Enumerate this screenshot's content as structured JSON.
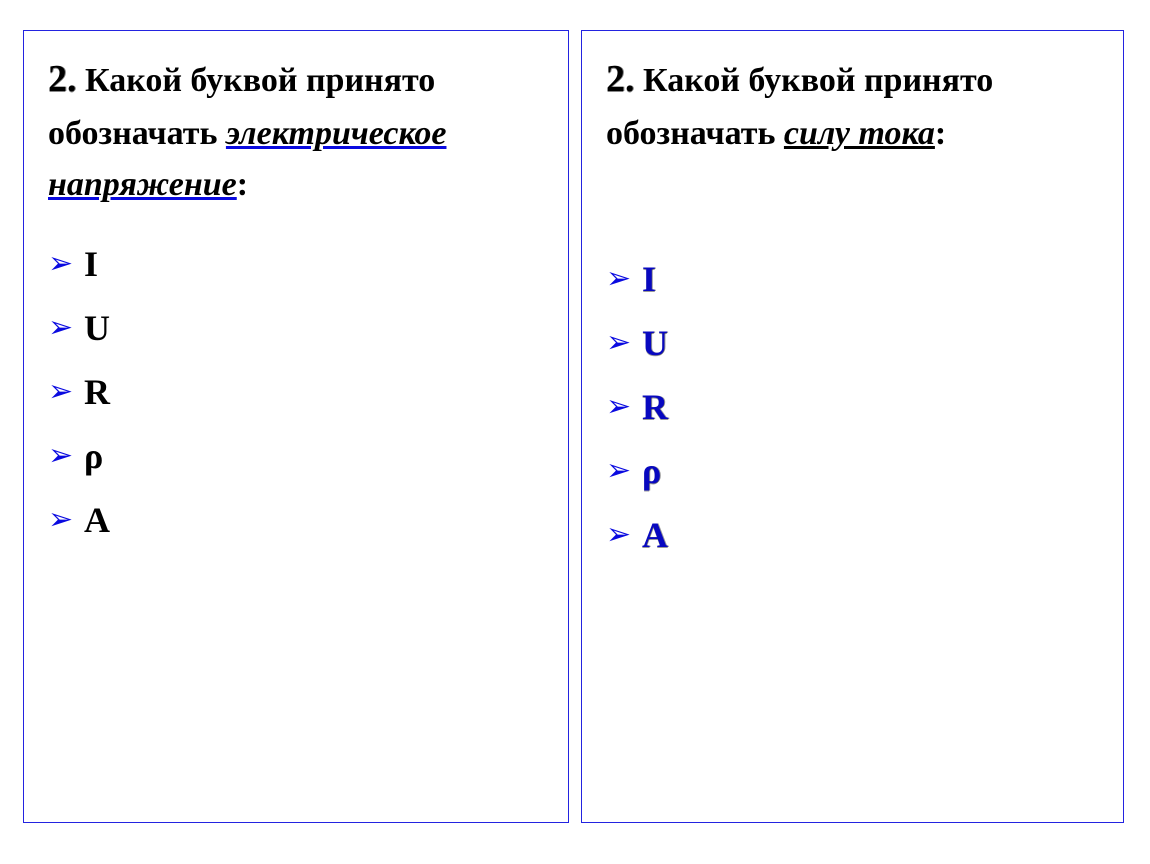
{
  "left": {
    "number": "2.",
    "text_before": " Какой буквой принято обозначать ",
    "keyword": "электрическое напряжение",
    "text_after": ":",
    "options": [
      "I",
      "U",
      "R",
      "ρ",
      "A"
    ]
  },
  "right": {
    "number": "2.",
    "text_before": " Какой буквой принято обозначать ",
    "keyword": "силу тока",
    "text_after": ":",
    "options": [
      "I",
      "U",
      "R",
      "ρ",
      "A"
    ]
  },
  "bullet": "➢"
}
